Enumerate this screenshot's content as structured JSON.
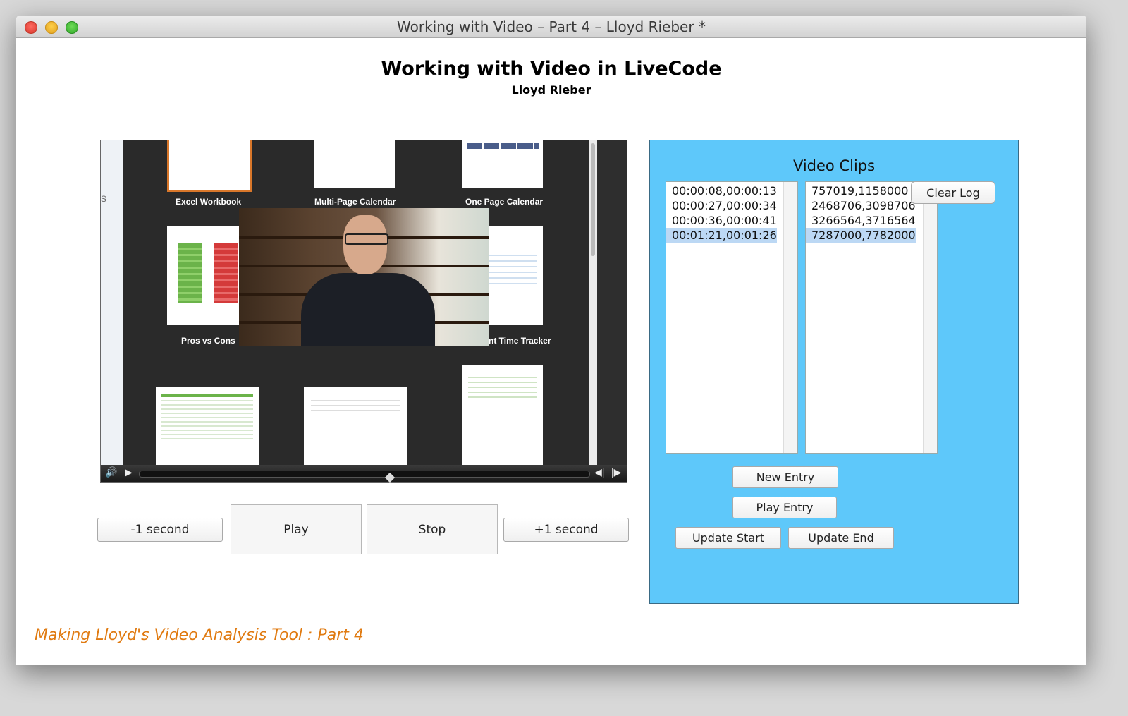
{
  "window": {
    "title": "Working with Video – Part 4 – Lloyd Rieber *"
  },
  "header": {
    "title": "Working with Video in LiveCode",
    "subtitle": "Lloyd Rieber"
  },
  "video": {
    "thumbnails": {
      "excel_workbook": "Excel Workbook",
      "multi_page_calendar": "Multi-Page Calendar",
      "one_page_calendar": "One Page Calendar",
      "pros_vs_cons": "Pros vs Cons",
      "time_tracker": "nt Time Tracker"
    },
    "side_letter": "S"
  },
  "controls": {
    "minus_one": "-1 second",
    "play": "Play",
    "stop": "Stop",
    "plus_one": "+1 second"
  },
  "clips": {
    "title": "Video Clips",
    "times": [
      "00:00:08,00:00:13",
      "00:00:27,00:00:34",
      "00:00:36,00:00:41",
      "00:01:21,00:01:26"
    ],
    "ms": [
      "757019,1158000",
      "2468706,3098706",
      "3266564,3716564",
      "7287000,7782000"
    ],
    "selected_index": 3,
    "clear_log": "Clear Log",
    "new_entry": "New Entry",
    "play_entry": "Play Entry",
    "update_start": "Update Start",
    "update_end": "Update End",
    "panel_color": "#5ec8fa"
  },
  "footer": {
    "text": "Making Lloyd's Video Analysis Tool : Part 4",
    "color": "#e07a10"
  }
}
